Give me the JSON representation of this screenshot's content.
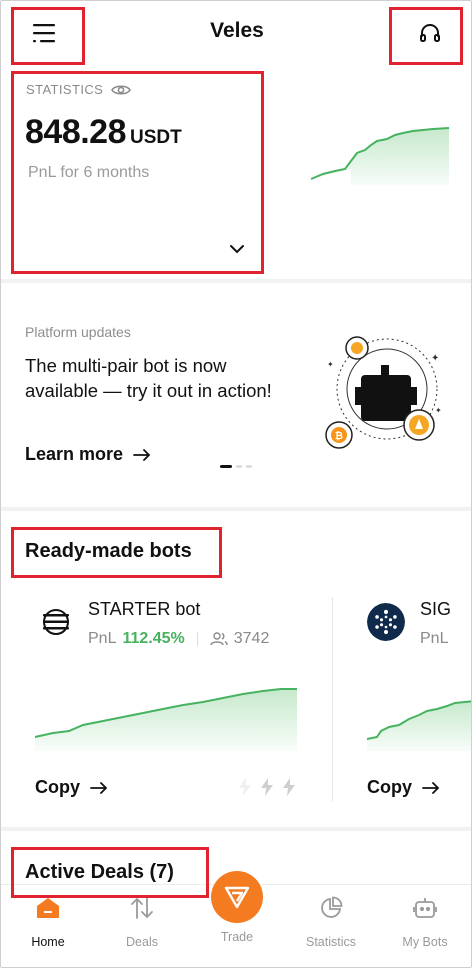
{
  "header": {
    "title": "Veles"
  },
  "stats": {
    "label": "STATISTICS",
    "value": "848.28",
    "unit": "USDT",
    "subtitle": "PnL for 6 months"
  },
  "updates": {
    "kicker": "Platform updates",
    "text": "The multi-pair bot is now available — try it out in action!",
    "cta": "Learn more",
    "pages": 3,
    "active_page": 1
  },
  "ready_bots": {
    "title": "Ready-made bots",
    "bots": [
      {
        "name": "STARTER bot",
        "pnl_label": "PnL",
        "pnl_value": "112.45%",
        "followers": "3742",
        "copy_label": "Copy"
      },
      {
        "name": "SIG",
        "pnl_label": "PnL",
        "copy_label": "Copy"
      }
    ]
  },
  "active_deals": {
    "title": "Active Deals (7)"
  },
  "nav": {
    "items": [
      {
        "label": "Home",
        "icon": "home-icon",
        "active": true
      },
      {
        "label": "Deals",
        "icon": "deals-arrows-icon",
        "active": false
      },
      {
        "label": "Trade",
        "icon": "trade-logo-icon",
        "active": false
      },
      {
        "label": "Statistics",
        "icon": "pie-chart-icon",
        "active": false
      },
      {
        "label": "My Bots",
        "icon": "robot-icon",
        "active": false
      }
    ]
  },
  "colors": {
    "accent": "#f47b20",
    "positive": "#47b25f",
    "highlight_box": "#e0232f"
  }
}
